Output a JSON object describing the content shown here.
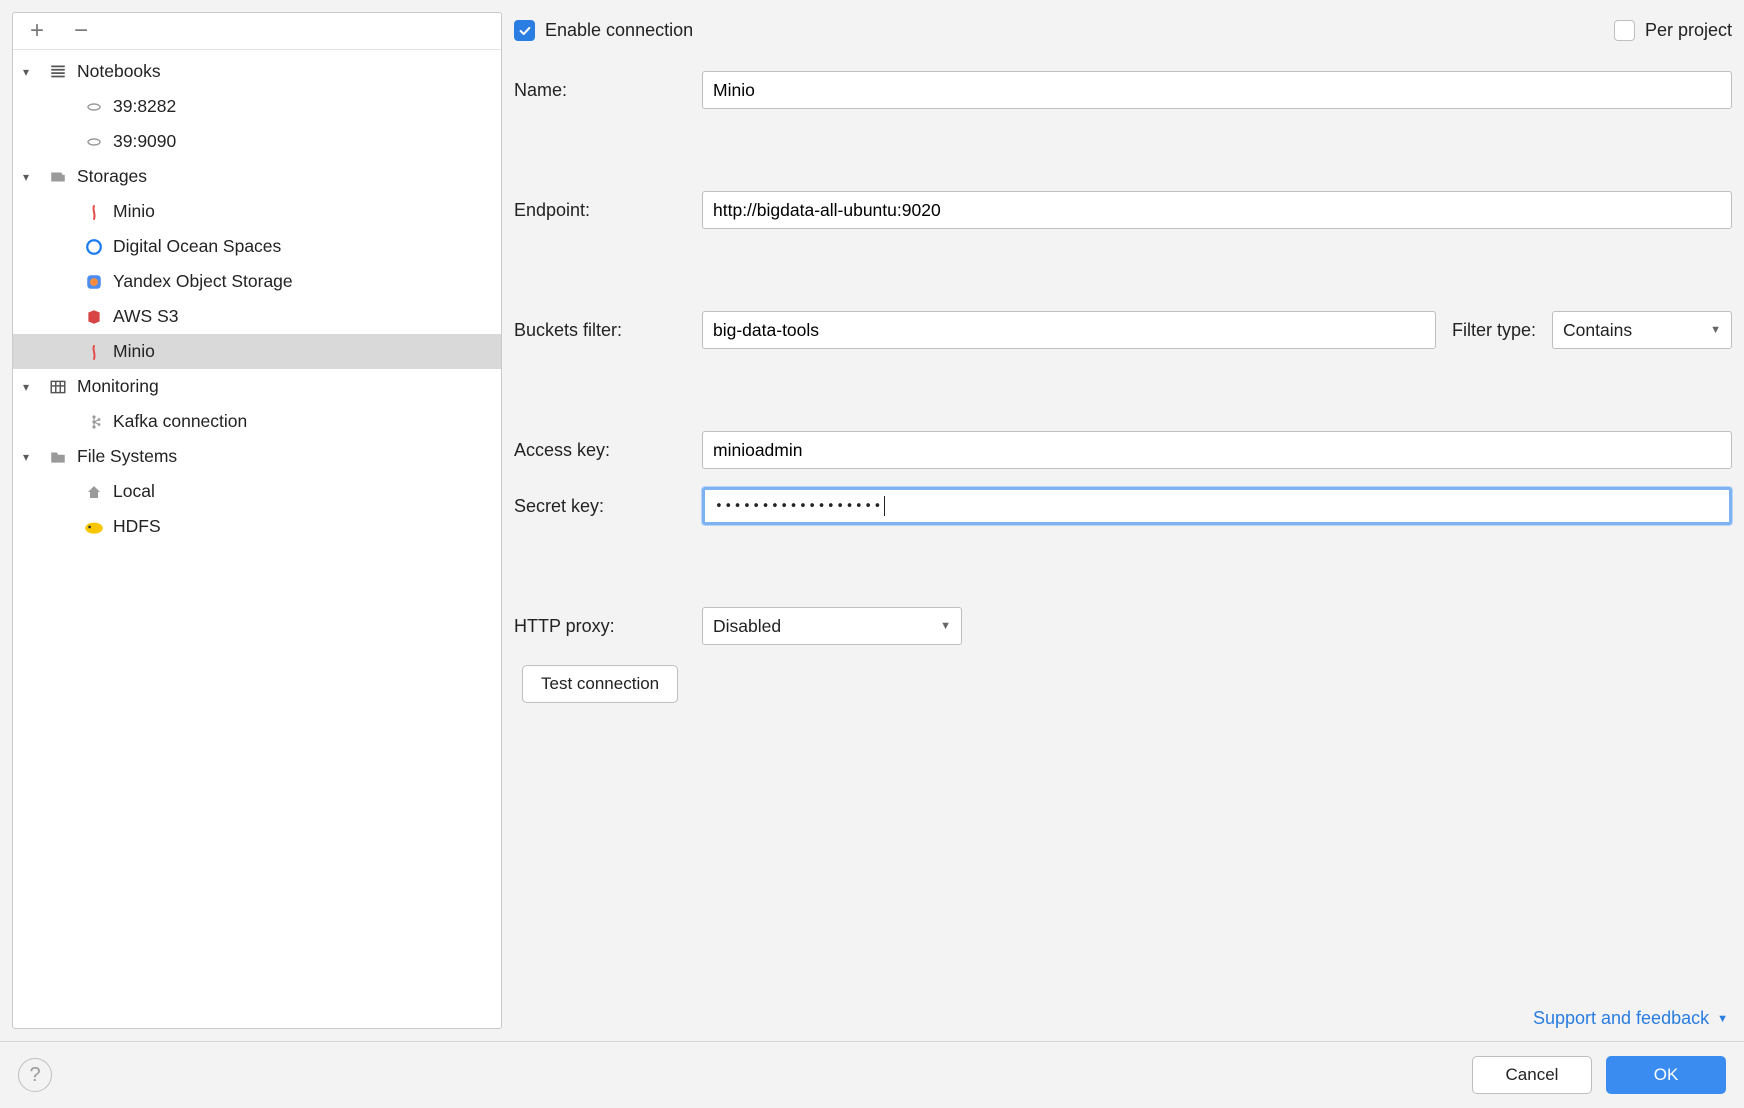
{
  "toolbar": {
    "add": "+",
    "remove": "−"
  },
  "sidebar": {
    "groups": [
      {
        "label": "Notebooks",
        "icon": "notebooks-icon",
        "children": [
          {
            "label": "39:8282",
            "icon": "link-icon"
          },
          {
            "label": "39:9090",
            "icon": "link-icon"
          }
        ]
      },
      {
        "label": "Storages",
        "icon": "storages-icon",
        "children": [
          {
            "label": "Minio",
            "icon": "minio-icon"
          },
          {
            "label": "Digital Ocean Spaces",
            "icon": "digitalocean-icon"
          },
          {
            "label": "Yandex Object Storage",
            "icon": "yandex-icon"
          },
          {
            "label": "AWS S3",
            "icon": "aws-s3-icon"
          },
          {
            "label": "Minio",
            "icon": "minio-icon",
            "selected": true
          }
        ]
      },
      {
        "label": "Monitoring",
        "icon": "monitoring-icon",
        "children": [
          {
            "label": "Kafka connection",
            "icon": "kafka-icon"
          }
        ]
      },
      {
        "label": "File Systems",
        "icon": "filesystems-icon",
        "children": [
          {
            "label": "Local",
            "icon": "home-icon"
          },
          {
            "label": "HDFS",
            "icon": "hdfs-icon"
          }
        ]
      }
    ]
  },
  "form": {
    "enable_label": "Enable connection",
    "enable_checked": true,
    "per_project_label": "Per project",
    "per_project_checked": false,
    "name_label": "Name:",
    "name_value": "Minio",
    "endpoint_label": "Endpoint:",
    "endpoint_value": "http://bigdata-all-ubuntu:9020",
    "buckets_filter_label": "Buckets filter:",
    "buckets_filter_value": "big-data-tools",
    "filter_type_label": "Filter type:",
    "filter_type_value": "Contains",
    "access_key_label": "Access key:",
    "access_key_value": "minioadmin",
    "secret_key_label": "Secret key:",
    "secret_key_value": "••••••••••••••••••",
    "http_proxy_label": "HTTP proxy:",
    "http_proxy_value": "Disabled",
    "test_connection_label": "Test connection",
    "support_link": "Support and feedback"
  },
  "footer": {
    "cancel": "Cancel",
    "ok": "OK"
  }
}
